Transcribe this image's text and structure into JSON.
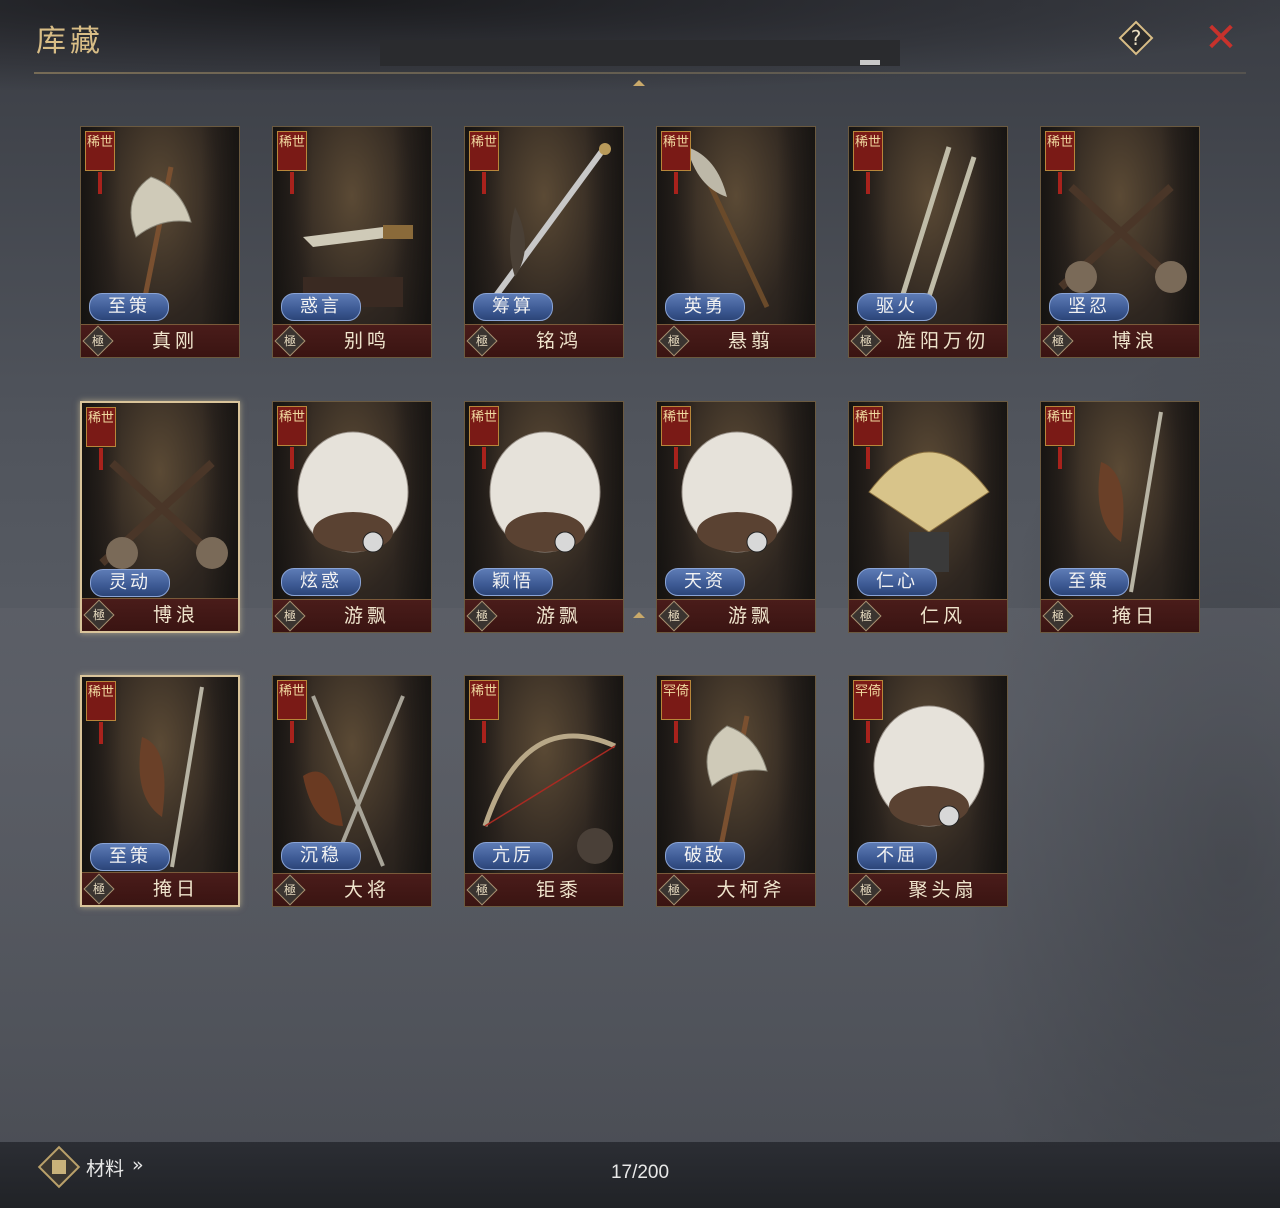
{
  "header": {
    "title": "库藏",
    "help_label": "?",
    "close_label": "✕"
  },
  "colors": {
    "accent_gold": "#d8bd86",
    "close_red": "#c8322c",
    "trait_blue": "#3d5a94",
    "name_bar": "#4a1c1a"
  },
  "items": [
    {
      "rarity": "稀世",
      "trait": "至策",
      "grade": "極",
      "name": "真刚",
      "art": "axe-icon"
    },
    {
      "rarity": "稀世",
      "trait": "惑言",
      "grade": "極",
      "name": "别鸣",
      "art": "dagger-icon"
    },
    {
      "rarity": "稀世",
      "trait": "筹算",
      "grade": "極",
      "name": "铭鸿",
      "art": "sword-icon"
    },
    {
      "rarity": "稀世",
      "trait": "英勇",
      "grade": "極",
      "name": "悬翦",
      "art": "glaive-icon"
    },
    {
      "rarity": "稀世",
      "trait": "驱火",
      "grade": "極",
      "name": "旌阳万仞",
      "art": "twin-swords-icon"
    },
    {
      "rarity": "稀世",
      "trait": "坚忍",
      "grade": "極",
      "name": "博浪",
      "art": "maces-icon"
    },
    {
      "rarity": "稀世",
      "trait": "灵动",
      "grade": "極",
      "name": "博浪",
      "art": "maces-icon"
    },
    {
      "rarity": "稀世",
      "trait": "炫惑",
      "grade": "極",
      "name": "游飘",
      "art": "feather-fan-icon"
    },
    {
      "rarity": "稀世",
      "trait": "颖悟",
      "grade": "極",
      "name": "游飘",
      "art": "feather-fan-icon"
    },
    {
      "rarity": "稀世",
      "trait": "天资",
      "grade": "極",
      "name": "游飘",
      "art": "feather-fan-icon"
    },
    {
      "rarity": "稀世",
      "trait": "仁心",
      "grade": "極",
      "name": "仁风",
      "art": "folding-fan-icon"
    },
    {
      "rarity": "稀世",
      "trait": "至策",
      "grade": "極",
      "name": "掩日",
      "art": "halberd-icon"
    },
    {
      "rarity": "稀世",
      "trait": "至策",
      "grade": "極",
      "name": "掩日",
      "art": "halberd-icon"
    },
    {
      "rarity": "稀世",
      "trait": "沉稳",
      "grade": "極",
      "name": "大将",
      "art": "spears-icon"
    },
    {
      "rarity": "稀世",
      "trait": "亢厉",
      "grade": "極",
      "name": "钜黍",
      "art": "bow-icon"
    },
    {
      "rarity": "罕倚",
      "trait": "破敌",
      "grade": "極",
      "name": "大柯斧",
      "art": "axe-icon"
    },
    {
      "rarity": "罕倚",
      "trait": "不屈",
      "grade": "極",
      "name": "聚头扇",
      "art": "feather-fan-icon"
    }
  ],
  "footer": {
    "materials_label": "材料",
    "materials_arrow": "»",
    "count": "17/200"
  }
}
